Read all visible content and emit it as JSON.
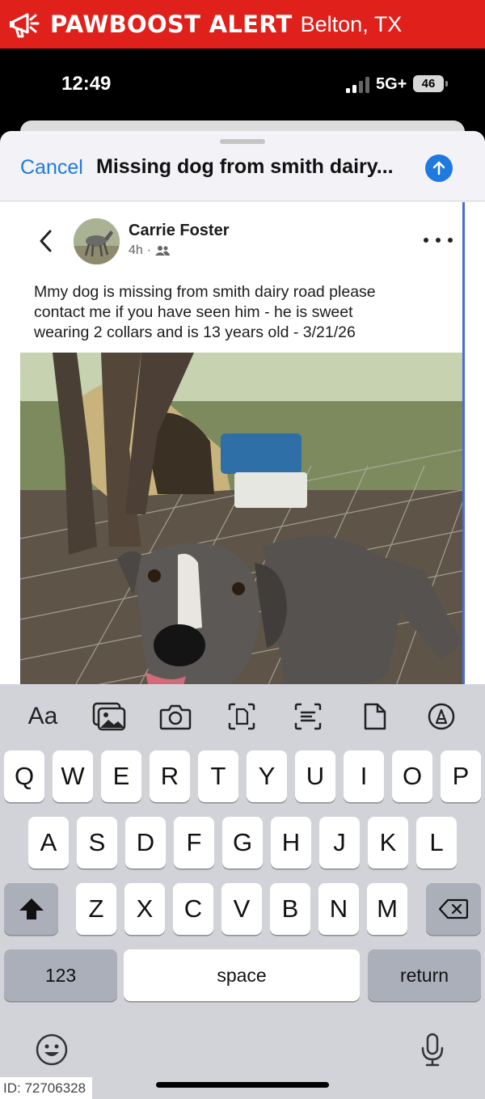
{
  "alert": {
    "brand": "PAWBOOST ALERT",
    "location": "Belton, TX"
  },
  "status": {
    "time": "12:49",
    "network": "5G+",
    "battery": "46"
  },
  "sheet": {
    "cancel_label": "Cancel",
    "title": "Missing dog from smith dairy..."
  },
  "post": {
    "author": "Carrie Foster",
    "time_ago": "4h",
    "separator": "·",
    "text_lines": [
      "Mmy dog is missing from smith dairy road  please",
      "contact me if you have seen him - he is sweet",
      "wearing 2 collars and is 13 years old -  3/21/26"
    ]
  },
  "keyboard": {
    "toolbar": {
      "font_label": "Aa"
    },
    "row1": [
      "Q",
      "W",
      "E",
      "R",
      "T",
      "Y",
      "U",
      "I",
      "O",
      "P"
    ],
    "row2": [
      "A",
      "S",
      "D",
      "F",
      "G",
      "H",
      "J",
      "K",
      "L"
    ],
    "row3": [
      "Z",
      "X",
      "C",
      "V",
      "B",
      "N",
      "M"
    ],
    "numbers_label": "123",
    "space_label": "space",
    "return_label": "return"
  },
  "footer": {
    "id_label": "ID: 72706328"
  },
  "colors": {
    "alert_red": "#e0201b",
    "ios_blue": "#1f7ae0",
    "keyboard_bg": "#d1d3d9"
  }
}
